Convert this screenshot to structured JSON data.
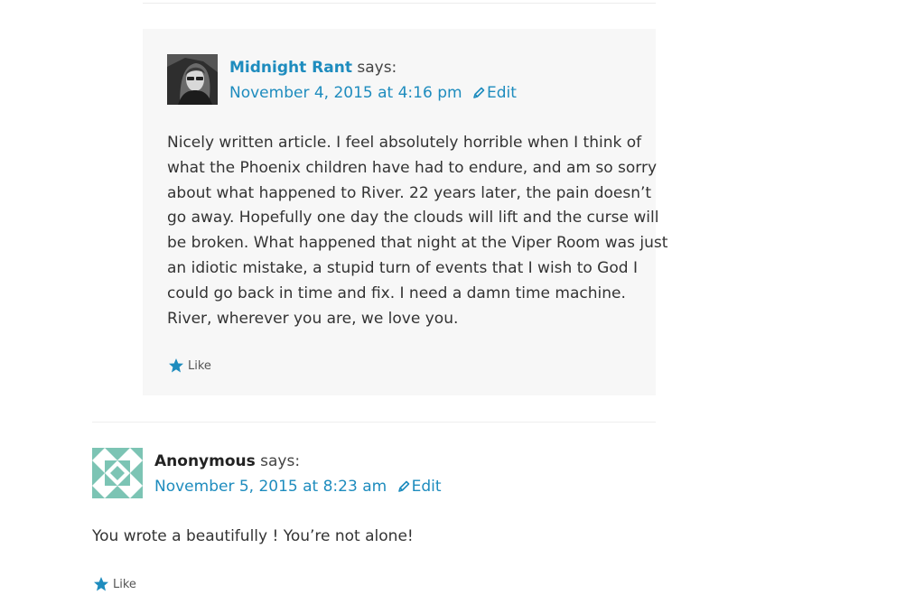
{
  "comment1": {
    "author": "Midnight Rant",
    "says": "says:",
    "date": "November 4, 2015 at 4:16 pm",
    "edit_label": "Edit",
    "body_lines": [
      "Nicely written article. I feel absolutely horrible when I think of",
      "what the Phoenix children have had to endure, and am so sorry",
      "about what happened to River. 22 years later, the pain doesn’t",
      "go away. Hopefully one day the clouds will lift and the curse will",
      "be broken. What happened that night at the Viper Room was just",
      "an idiotic mistake, a stupid turn of events that I wish to God I",
      "could go back in time and fix. I need a damn time machine.",
      "River, wherever you are, we love you."
    ],
    "like_label": "Like"
  },
  "comment2": {
    "author": "Anonymous",
    "says": "says:",
    "date": "November 5, 2015 at 8:23 am",
    "edit_label": "Edit",
    "body": "You wrote a beautifully ! You’re not alone!",
    "like_label": "Like"
  },
  "icons": {
    "edit": "pencil-icon",
    "like": "star-icon",
    "avatar1": "user-photo-avatar",
    "avatar2": "identicon-avatar"
  },
  "colors": {
    "link": "#1e8cbe",
    "reply_background": "#f7f7f7",
    "identicon": "#7cc4b4"
  }
}
